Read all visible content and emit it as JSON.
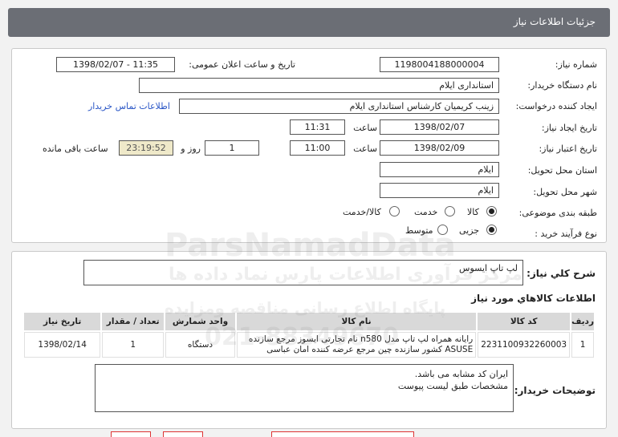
{
  "header": {
    "title": "جزئیات اطلاعات نیاز"
  },
  "form": {
    "need_number_label": "شماره نیاز:",
    "need_number": "1198004188000004",
    "announce_label": "تاریخ و ساعت اعلان عمومی:",
    "announce_value": "1398/02/07 - 11:35",
    "buyer_org_label": "نام دستگاه خریدار:",
    "buyer_org": "استانداری ایلام",
    "requester_label": "ایجاد کننده درخواست:",
    "requester": "زینب کریمیان کارشناس استانداری ایلام",
    "contact_link": "اطلاعات تماس خریدار",
    "created_label": "تاریخ ایجاد نیاز:",
    "created_date": "1398/02/07",
    "time_label": "ساعت",
    "created_time": "11:31",
    "validity_label": "تاریخ اعتبار نیاز:",
    "validity_date": "1398/02/09",
    "validity_time": "11:00",
    "day_and_label": "روز و",
    "days": "1",
    "remaining_time": "23:19:52",
    "remaining_label": "ساعت باقی مانده",
    "province_label": "استان محل تحویل:",
    "province": "ایلام",
    "city_label": "شهر محل تحویل:",
    "city": "ایلام",
    "category_label": "طبقه بندی موضوعی:",
    "category_options": [
      "کالا",
      "خدمت",
      "کالا/خدمت"
    ],
    "category_selected": "کالا",
    "process_label": "نوع فرآیند خرید :",
    "process_options": [
      "جزیی",
      "متوسط"
    ],
    "process_selected": "جزیی"
  },
  "summary": {
    "label": "شرح کلي نياز:",
    "value": "لپ تاپ ایسوس"
  },
  "items_section": {
    "title": "اطلاعات کالاهاي مورد نياز",
    "columns": [
      "ردیف",
      "کد کالا",
      "نام کالا",
      "واحد شمارش",
      "تعداد / مقدار",
      "تاریخ نیاز"
    ],
    "rows": [
      {
        "row": "1",
        "code": "2231100932260003",
        "name": "رایانه همراه لپ تاپ مدل n580 نام تجارتی ایسوز مرجع سازنده ASUSE کشور سازنده چین مرجع عرضه کننده امان عباسی",
        "unit": "دستگاه",
        "qty": "1",
        "date": "1398/02/14"
      }
    ]
  },
  "buyer_notes": {
    "label": "توضیحات خریدار:",
    "lines": [
      "ایران کد مشابه می باشد.",
      "مشخصات طبق لیست پیوست"
    ]
  },
  "watermark": {
    "brand": "ParsNamadData",
    "line1": "مرکز فرآوری اطلاعات پارس نماد داده ها",
    "line2": "پایگاه اطلاع رسانی مناقصه ومزایده",
    "phone": "021-88349670"
  },
  "colors": {
    "titlebar": "#6b6e75",
    "link": "#2a56c6",
    "remaining_bg": "#efe9c9",
    "table_header": "#d9d9d9"
  }
}
